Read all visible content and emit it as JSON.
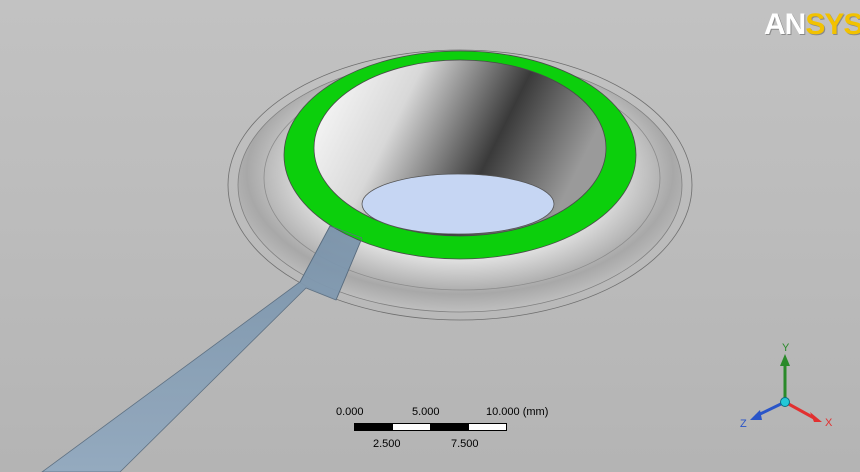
{
  "logo": {
    "part1": "AN",
    "part2": "SYS"
  },
  "scale_bar": {
    "top_labels": [
      "0.000",
      "5.000",
      "10.000 (mm)"
    ],
    "bottom_labels": [
      "2.500",
      "7.500"
    ]
  },
  "triad": {
    "y_label": "Y",
    "x_label": "X",
    "z_label": "Z"
  },
  "colors": {
    "background": "#bdbdbd",
    "highlight_face": "#00d400",
    "selected_face": "#8ea6bd",
    "hole_interior": "#c5d6f2",
    "axis_x": "#e23030",
    "axis_y": "#2a8a2a",
    "axis_z": "#2a55c8"
  }
}
